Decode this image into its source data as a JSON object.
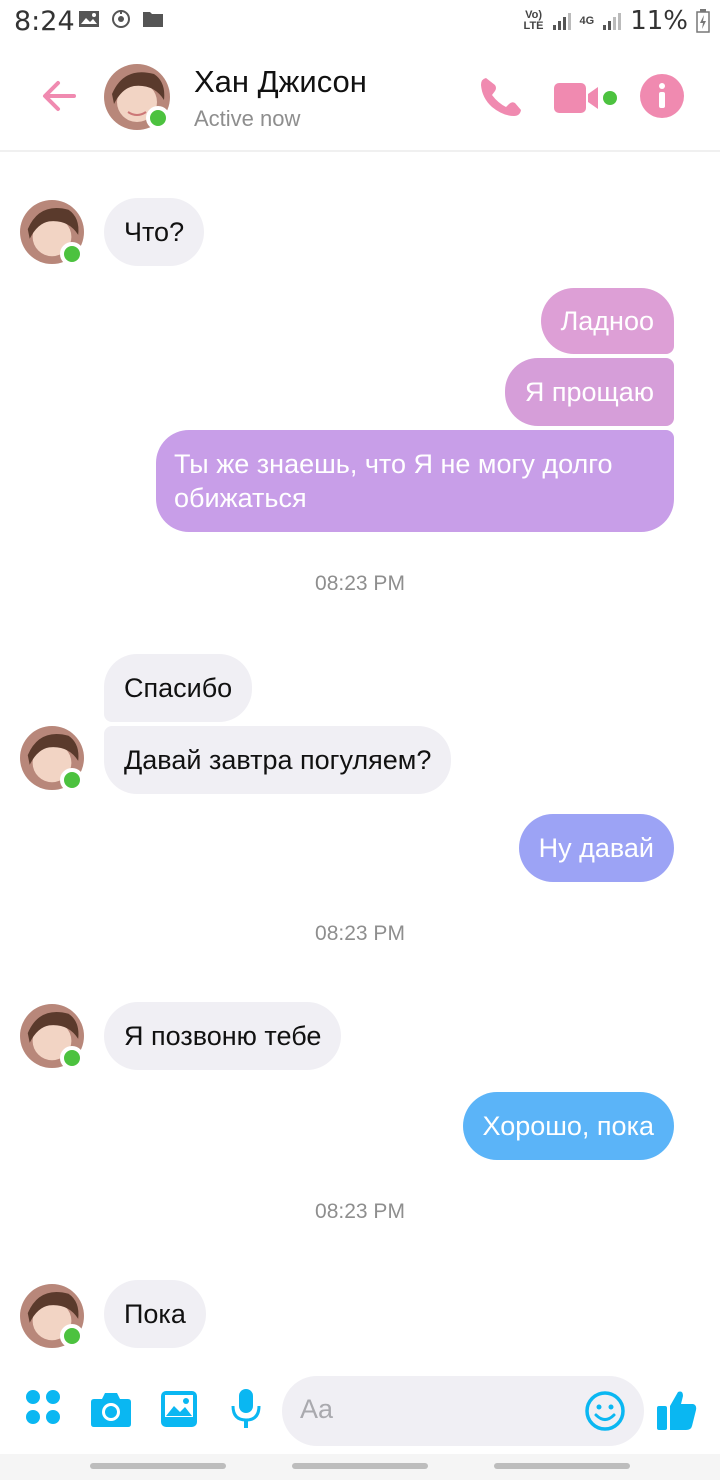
{
  "status_bar": {
    "time": "8:24",
    "network_label": "Vo)\nLTE",
    "network_4g": "4G",
    "battery_percent": "11%"
  },
  "header": {
    "contact_name": "Хан Джисон",
    "presence": "Active now"
  },
  "messages": [
    {
      "side": "in",
      "text": "Что?"
    },
    {
      "side": "out",
      "text": "Ладноо"
    },
    {
      "side": "out",
      "text": "Я прощаю"
    },
    {
      "side": "out",
      "text": "Ты же знаешь, что Я не могу долго обижаться"
    },
    {
      "side": "time",
      "text": "08:23 PM"
    },
    {
      "side": "in",
      "text": "Спасибо"
    },
    {
      "side": "in",
      "text": "Давай завтра погуляем?"
    },
    {
      "side": "out",
      "text": "Ну давай"
    },
    {
      "side": "time",
      "text": "08:23 PM"
    },
    {
      "side": "in",
      "text": "Я позвоню тебе"
    },
    {
      "side": "out",
      "text": "Хорошо, пока"
    },
    {
      "side": "time",
      "text": "08:23 PM"
    },
    {
      "side": "in",
      "text": "Пока"
    }
  ],
  "composer": {
    "placeholder": "Aa"
  },
  "colors": {
    "accent_pink": "#f08ab0",
    "online_green": "#4cc23f",
    "incoming_bubble": "#f0eff4",
    "messenger_blue": "#0ab7f2"
  },
  "icons": [
    "back-arrow-icon",
    "phone-icon",
    "video-camera-icon",
    "info-icon",
    "menu-grid-icon",
    "camera-icon",
    "gallery-icon",
    "microphone-icon",
    "emoji-icon",
    "thumbs-up-icon"
  ]
}
